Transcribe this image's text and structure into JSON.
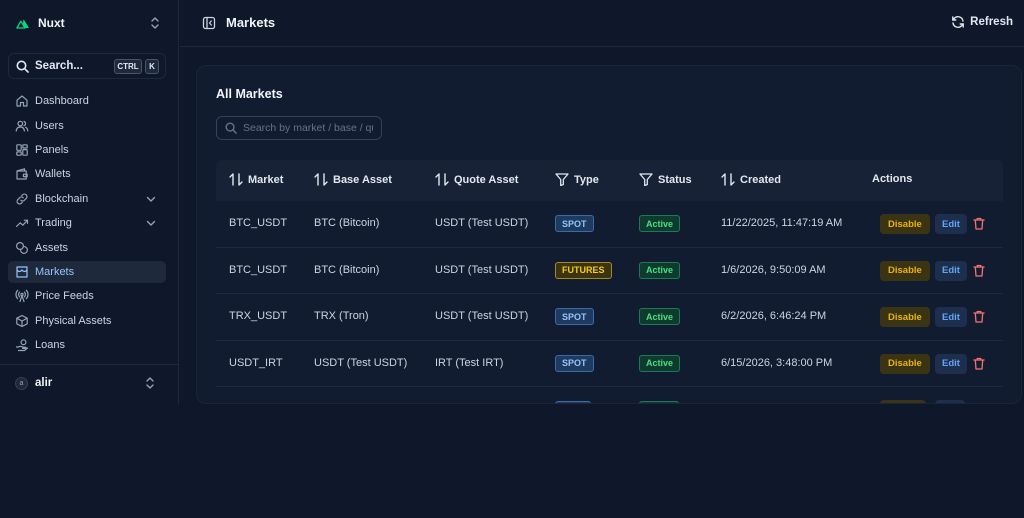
{
  "brand": {
    "name": "Nuxt",
    "logo_icon": "nuxt-logo-icon"
  },
  "search": {
    "label": "Search...",
    "shortcut_ctrl": "CTRL",
    "shortcut_key": "K"
  },
  "sidebar": {
    "items": [
      {
        "label": "Dashboard",
        "icon": "home-icon",
        "active": false
      },
      {
        "label": "Users",
        "icon": "users-icon",
        "active": false
      },
      {
        "label": "Panels",
        "icon": "panels-icon",
        "active": false
      },
      {
        "label": "Wallets",
        "icon": "wallet-icon",
        "active": false
      },
      {
        "label": "Blockchain",
        "icon": "link-icon",
        "active": false,
        "expandable": true
      },
      {
        "label": "Trading",
        "icon": "trending-icon",
        "active": false,
        "expandable": true
      },
      {
        "label": "Assets",
        "icon": "coins-icon",
        "active": false
      },
      {
        "label": "Markets",
        "icon": "store-icon",
        "active": true
      },
      {
        "label": "Price Feeds",
        "icon": "radio-tower-icon",
        "active": false
      },
      {
        "label": "Physical Assets",
        "icon": "box-icon",
        "active": false
      },
      {
        "label": "Loans",
        "icon": "hand-coins-icon",
        "active": false
      }
    ],
    "user": {
      "name": "alir",
      "avatar_initial": "a"
    }
  },
  "header": {
    "title": "Markets",
    "refresh_label": "Refresh"
  },
  "card": {
    "title": "All Markets",
    "search_placeholder": "Search by market / base / quote"
  },
  "table": {
    "columns": {
      "market": "Market",
      "base": "Base Asset",
      "quote": "Quote Asset",
      "type": "Type",
      "status": "Status",
      "created": "Created",
      "actions": "Actions"
    },
    "rows": [
      {
        "market": "BTC_USDT",
        "base": "BTC (Bitcoin)",
        "quote": "USDT (Test USDT)",
        "type": "SPOT",
        "status": "Active",
        "created": "11/22/2025, 11:47:19 AM",
        "disable": "Disable",
        "edit": "Edit"
      },
      {
        "market": "BTC_USDT",
        "base": "BTC (Bitcoin)",
        "quote": "USDT (Test USDT)",
        "type": "FUTURES",
        "status": "Active",
        "created": "1/6/2026, 9:50:09 AM",
        "disable": "Disable",
        "edit": "Edit"
      },
      {
        "market": "TRX_USDT",
        "base": "TRX (Tron)",
        "quote": "USDT (Test USDT)",
        "type": "SPOT",
        "status": "Active",
        "created": "6/2/2026, 6:46:24 PM",
        "disable": "Disable",
        "edit": "Edit"
      },
      {
        "market": "USDT_IRT",
        "base": "USDT (Test USDT)",
        "quote": "IRT (Test IRT)",
        "type": "SPOT",
        "status": "Active",
        "created": "6/15/2026, 3:48:00 PM",
        "disable": "Disable",
        "edit": "Edit"
      }
    ]
  },
  "colors": {
    "background": "#0f172a",
    "accent": "#93c5fd",
    "spot": "#93c5fd",
    "futures": "#facc15",
    "active": "#4ade80",
    "danger": "#f87171"
  }
}
